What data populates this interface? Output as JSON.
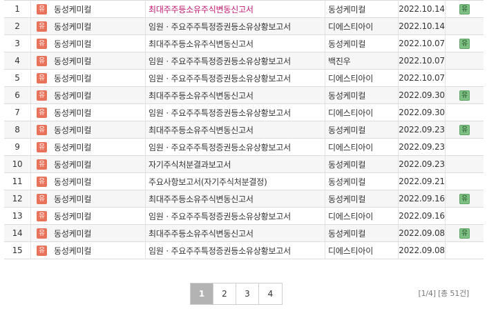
{
  "market_badge": "유",
  "note_badge": "유",
  "rows": [
    {
      "no": "1",
      "corp": "동성케미컬",
      "report": "최대주주등소유주식변동신고서",
      "filer": "동성케미컬",
      "date": "2022.10.14",
      "note": "유",
      "highlight": true
    },
    {
      "no": "2",
      "corp": "동성케미컬",
      "report": "임원ㆍ주요주주특정증권등소유상황보고서",
      "filer": "디에스티아이",
      "date": "2022.10.14",
      "note": ""
    },
    {
      "no": "3",
      "corp": "동성케미컬",
      "report": "최대주주등소유주식변동신고서",
      "filer": "동성케미컬",
      "date": "2022.10.07",
      "note": "유"
    },
    {
      "no": "4",
      "corp": "동성케미컬",
      "report": "임원ㆍ주요주주특정증권등소유상황보고서",
      "filer": "백진우",
      "date": "2022.10.07",
      "note": ""
    },
    {
      "no": "5",
      "corp": "동성케미컬",
      "report": "임원ㆍ주요주주특정증권등소유상황보고서",
      "filer": "디에스티아이",
      "date": "2022.10.07",
      "note": ""
    },
    {
      "no": "6",
      "corp": "동성케미컬",
      "report": "최대주주등소유주식변동신고서",
      "filer": "동성케미컬",
      "date": "2022.09.30",
      "note": "유"
    },
    {
      "no": "7",
      "corp": "동성케미컬",
      "report": "임원ㆍ주요주주특정증권등소유상황보고서",
      "filer": "디에스티아이",
      "date": "2022.09.30",
      "note": ""
    },
    {
      "no": "8",
      "corp": "동성케미컬",
      "report": "최대주주등소유주식변동신고서",
      "filer": "동성케미컬",
      "date": "2022.09.23",
      "note": "유"
    },
    {
      "no": "9",
      "corp": "동성케미컬",
      "report": "임원ㆍ주요주주특정증권등소유상황보고서",
      "filer": "디에스티아이",
      "date": "2022.09.23",
      "note": ""
    },
    {
      "no": "10",
      "corp": "동성케미컬",
      "report": "자기주식처분결과보고서",
      "filer": "동성케미컬",
      "date": "2022.09.23",
      "note": ""
    },
    {
      "no": "11",
      "corp": "동성케미컬",
      "report": "주요사항보고서(자기주식처분결정)",
      "filer": "동성케미컬",
      "date": "2022.09.21",
      "note": ""
    },
    {
      "no": "12",
      "corp": "동성케미컬",
      "report": "최대주주등소유주식변동신고서",
      "filer": "동성케미컬",
      "date": "2022.09.16",
      "note": "유"
    },
    {
      "no": "13",
      "corp": "동성케미컬",
      "report": "임원ㆍ주요주주특정증권등소유상황보고서",
      "filer": "디에스티아이",
      "date": "2022.09.16",
      "note": ""
    },
    {
      "no": "14",
      "corp": "동성케미컬",
      "report": "최대주주등소유주식변동신고서",
      "filer": "동성케미컬",
      "date": "2022.09.08",
      "note": "유"
    },
    {
      "no": "15",
      "corp": "동성케미컬",
      "report": "임원ㆍ주요주주특정증권등소유상황보고서",
      "filer": "디에스티아이",
      "date": "2022.09.08",
      "note": ""
    }
  ],
  "pagination": {
    "pages": [
      "1",
      "2",
      "3",
      "4"
    ],
    "current": "1"
  },
  "summary": "[1/4] [총 51건]",
  "colors": {
    "market_badge": "#e9725b",
    "note_badge": "#7fc084",
    "highlight_link": "#c0186e",
    "active_page": "#b3b3b3"
  }
}
